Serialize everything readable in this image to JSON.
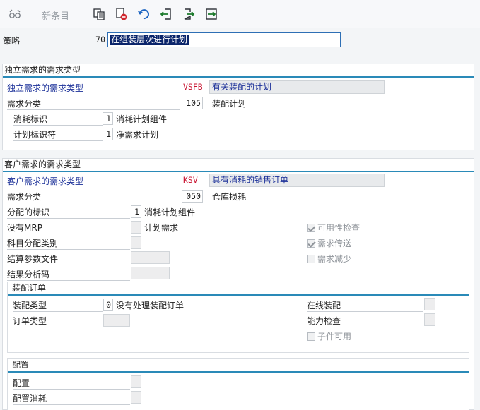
{
  "toolbar": {
    "new_entries": "新条目",
    "icons": [
      "glasses-icon",
      "copy-icon",
      "delete-icon",
      "undo-icon",
      "previous-entry-icon",
      "next-entry-icon",
      "other-entry-icon"
    ]
  },
  "strategy": {
    "label": "策略",
    "value": "70",
    "description": "在组装层次进行计划"
  },
  "independent": {
    "title": "独立需求的需求类型",
    "req_type_label": "独立需求的需求类型",
    "req_type_value": "VSFB",
    "req_type_desc": "有关装配的计划",
    "req_class_label": "需求分类",
    "req_class_value": "105",
    "req_class_desc": "装配计划",
    "consumption_label": "消耗标识",
    "consumption_value": "1",
    "consumption_desc": "消耗计划组件",
    "planning_label": "计划标识符",
    "planning_value": "1",
    "planning_desc": "净需求计划"
  },
  "customer": {
    "title": "客户需求的需求类型",
    "req_type_label": "客户需求的需求类型",
    "req_type_value": "KSV",
    "req_type_desc": "具有消耗的销售订单",
    "req_class_label": "需求分类",
    "req_class_value": "050",
    "req_class_desc": "仓库损耗",
    "allocation_label": "分配的标识",
    "allocation_value": "1",
    "allocation_desc": "消耗计划组件",
    "no_mrp_label": "没有MRP",
    "no_mrp_desc": "计划需求",
    "acct_label": "科目分配类别",
    "settlement_label": "结算参数文件",
    "result_label": "结果分析码",
    "chk_availability": "可用性检查",
    "chk_transfer": "需求传送",
    "chk_reduction": "需求减少",
    "assembly": {
      "title": "装配订单",
      "type_label": "装配类型",
      "type_value": "0",
      "type_desc": "没有处理装配订单",
      "order_type_label": "订单类型",
      "online_label": "在线装配",
      "capacity_label": "能力检查",
      "components_label": "子件可用"
    }
  },
  "config": {
    "title": "配置",
    "config_label": "配置",
    "consumption_label": "配置消耗"
  }
}
